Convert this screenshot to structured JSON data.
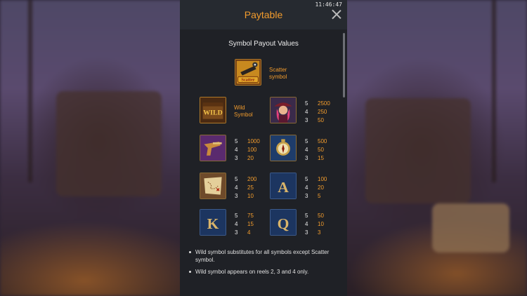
{
  "paytable": {
    "title": "Paytable",
    "clock": "11:46:47",
    "section_title": "Symbol Payout Values",
    "scatter": {
      "icon": "cannon-scatter-icon",
      "symbol_text": "Scatter",
      "label": "Scatter symbol"
    },
    "wild": {
      "icon": "wild-chest-icon",
      "symbol_text": "WILD",
      "label": "Wild Symbol"
    },
    "symbols": [
      {
        "icon": "pirate-captain-icon",
        "pays": [
          {
            "count": "5",
            "value": "2500"
          },
          {
            "count": "4",
            "value": "250"
          },
          {
            "count": "3",
            "value": "50"
          }
        ]
      },
      {
        "icon": "pistol-icon",
        "pays": [
          {
            "count": "5",
            "value": "1000"
          },
          {
            "count": "4",
            "value": "100"
          },
          {
            "count": "3",
            "value": "20"
          }
        ]
      },
      {
        "icon": "compass-icon",
        "pays": [
          {
            "count": "5",
            "value": "500"
          },
          {
            "count": "4",
            "value": "50"
          },
          {
            "count": "3",
            "value": "15"
          }
        ]
      },
      {
        "icon": "treasure-map-icon",
        "pays": [
          {
            "count": "5",
            "value": "200"
          },
          {
            "count": "4",
            "value": "25"
          },
          {
            "count": "3",
            "value": "10"
          }
        ]
      },
      {
        "icon": "letter-a-icon",
        "letter": "A",
        "pays": [
          {
            "count": "5",
            "value": "100"
          },
          {
            "count": "4",
            "value": "20"
          },
          {
            "count": "3",
            "value": "5"
          }
        ]
      },
      {
        "icon": "letter-k-icon",
        "letter": "K",
        "pays": [
          {
            "count": "5",
            "value": "75"
          },
          {
            "count": "4",
            "value": "15"
          },
          {
            "count": "3",
            "value": "4"
          }
        ]
      },
      {
        "icon": "letter-q-icon",
        "letter": "Q",
        "pays": [
          {
            "count": "5",
            "value": "50"
          },
          {
            "count": "4",
            "value": "10"
          },
          {
            "count": "3",
            "value": "3"
          }
        ]
      }
    ],
    "notes": [
      "Wild symbol substitutes for all symbols except Scatter symbol.",
      "Wild symbol appears on reels 2, 3 and 4 only."
    ]
  },
  "colors": {
    "accent": "#f29c2d",
    "panel": "#1f2126",
    "header": "#262a30"
  }
}
